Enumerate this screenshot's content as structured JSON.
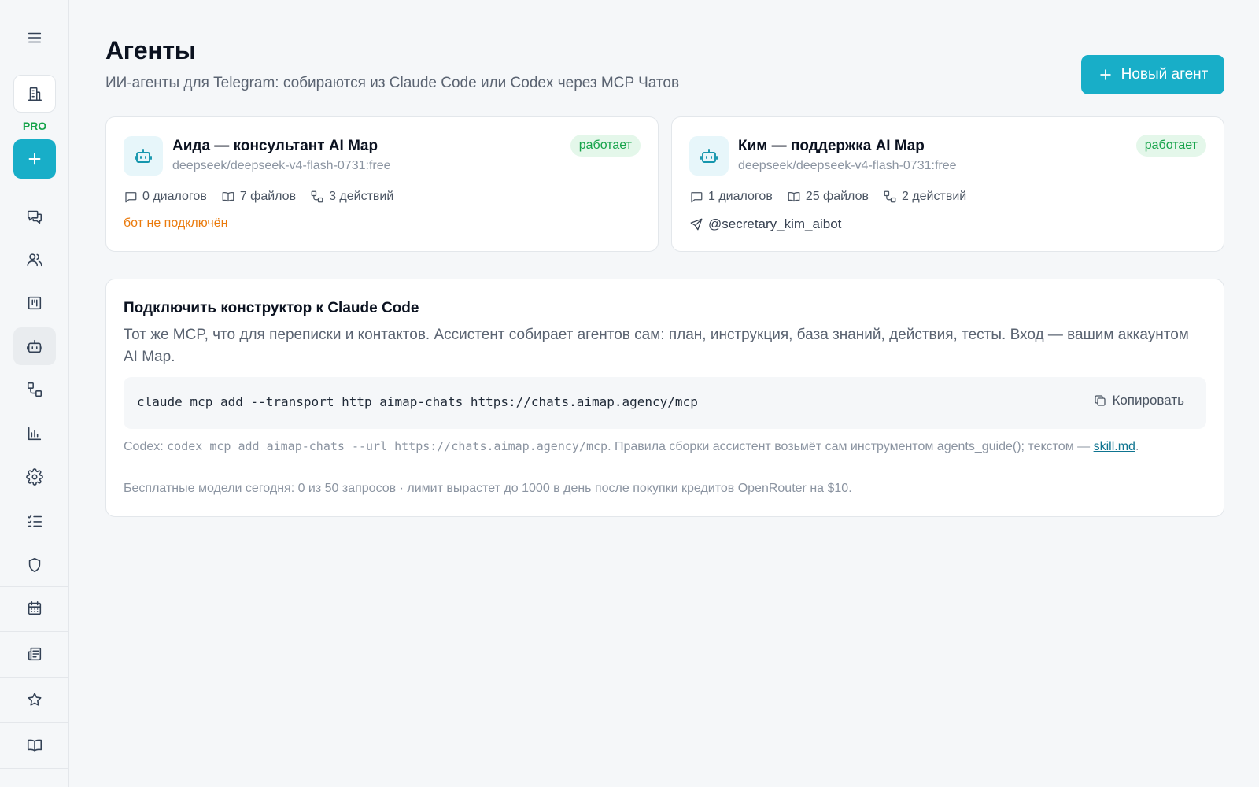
{
  "sidebar": {
    "pro_badge": "PRO",
    "icons": {
      "menu": "menu-icon",
      "org": "building-icon",
      "add": "plus-icon",
      "chats": "chats-icon",
      "contacts": "users-icon",
      "kanban": "kanban-icon",
      "agents": "bot-icon",
      "workflows": "workflow-icon",
      "analytics": "bar-chart-icon",
      "settings": "gear-icon",
      "tasks": "checklist-icon",
      "security": "shield-icon",
      "calendar": "calendar-icon",
      "news": "newspaper-icon",
      "favorites": "star-icon",
      "docs": "book-icon"
    },
    "active_item": "agents"
  },
  "header": {
    "title": "Агенты",
    "subtitle": "ИИ-агенты для Telegram: собираются из Claude Code или Codex через MCP Чатов",
    "new_agent_label": "Новый агент"
  },
  "agents": [
    {
      "name": "Аида — консультант AI Map",
      "model": "deepseek/deepseek-v4-flash-0731:free",
      "status": "работает",
      "dialogs": "0 диалогов",
      "files": "7 файлов",
      "actions": "3 действий",
      "bot_status": "бот не подключён"
    },
    {
      "name": "Ким — поддержка AI Map",
      "model": "deepseek/deepseek-v4-flash-0731:free",
      "status": "работает",
      "dialogs": "1 диалогов",
      "files": "25 файлов",
      "actions": "2 действий",
      "bot_handle": "@secretary_kim_aibot"
    }
  ],
  "connect": {
    "title": "Подключить конструктор к Claude Code",
    "description": "Тот же MCP, что для переписки и контактов. Ассистент собирает агентов сам: план, инструкция, база знаний, действия, тесты. Вход — вашим аккаунтом AI Map.",
    "command": "claude mcp add --transport http aimap-chats https://chats.aimap.agency/mcp",
    "copy_label": "Копировать",
    "codex_prefix": "Codex: ",
    "codex_command": "codex mcp add aimap-chats --url https://chats.aimap.agency/mcp",
    "codex_suffix": ". Правила сборки ассистент возьмёт сам инструментом agents_guide(); текстом — ",
    "skill_link": "skill.md",
    "codex_end": ".",
    "limits": "Бесплатные модели сегодня: 0 из 50 запросов · лимит вырастет до 1000 в день после покупки кредитов OpenRouter на $10."
  },
  "colors": {
    "accent": "#18aec8",
    "status_green": "#16a34a",
    "warning_orange": "#ea7a0c",
    "pro_green": "#16a34a"
  }
}
